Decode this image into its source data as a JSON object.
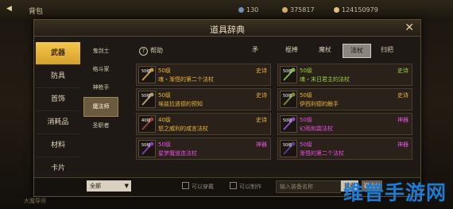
{
  "topbar": {
    "back_icon": "back-arrow-icon",
    "title": "背包",
    "stats": [
      "130",
      "375817",
      "124150979"
    ]
  },
  "panel": {
    "title": "道具辞典",
    "close_icon": "close-icon"
  },
  "categories": [
    "武器",
    "防具",
    "首饰",
    "消耗品",
    "材料",
    "卡片"
  ],
  "subcategories": [
    "鬼剑士",
    "格斗家",
    "神枪手",
    "魔法师",
    "圣职者"
  ],
  "help": "帮助",
  "tabs": [
    "矛",
    "棍棒",
    "魔杖",
    "法杖",
    "扫把"
  ],
  "items": [
    {
      "lv": "50级",
      "level": "50级",
      "grade": "史诗",
      "name": "魂・渐悟的第二个法杖",
      "tier": "epic",
      "color": "#c79a3a"
    },
    {
      "lv": "50级",
      "level": "50级",
      "grade": "史诗",
      "name": "魂・末日君主的法杖",
      "tier": "rare",
      "color": "#7db44a"
    },
    {
      "lv": "50级",
      "level": "50级",
      "grade": "史诗",
      "name": "埃兹拉遗德的预知",
      "tier": "epic",
      "color": "#b49b6a"
    },
    {
      "lv": "50级",
      "level": "50级",
      "grade": "史诗",
      "name": "伊西利德的触手",
      "tier": "epic",
      "color": "#7b8a3a"
    },
    {
      "lv": "40级",
      "level": "40级",
      "grade": "史诗",
      "name": "怒之威利的咸言法杖",
      "tier": "epic",
      "color": "#9d3c3c"
    },
    {
      "lv": "50级",
      "level": "50级",
      "grade": "神器",
      "name": "幻雨和霜法杖",
      "tier": "myth",
      "color": "#8a4dc2"
    },
    {
      "lv": "50级",
      "level": "50级",
      "grade": "神器",
      "name": "星梦魔道连法杖",
      "tier": "myth",
      "color": "#7e3cb0"
    },
    {
      "lv": "50级",
      "level": "50级",
      "grade": "神器",
      "name": "渐悟的第二个法杖",
      "tier": "myth",
      "color": "#5a3a8c"
    }
  ],
  "bottom": {
    "filter": "全部",
    "check1": "可以穿戴",
    "check2": "可以制作",
    "search_placeholder": "输入装备名称",
    "search_btn": "搜索",
    "reset_btn": "初始化"
  },
  "watermark": "维普手游网",
  "lower_label": "大魔导师"
}
